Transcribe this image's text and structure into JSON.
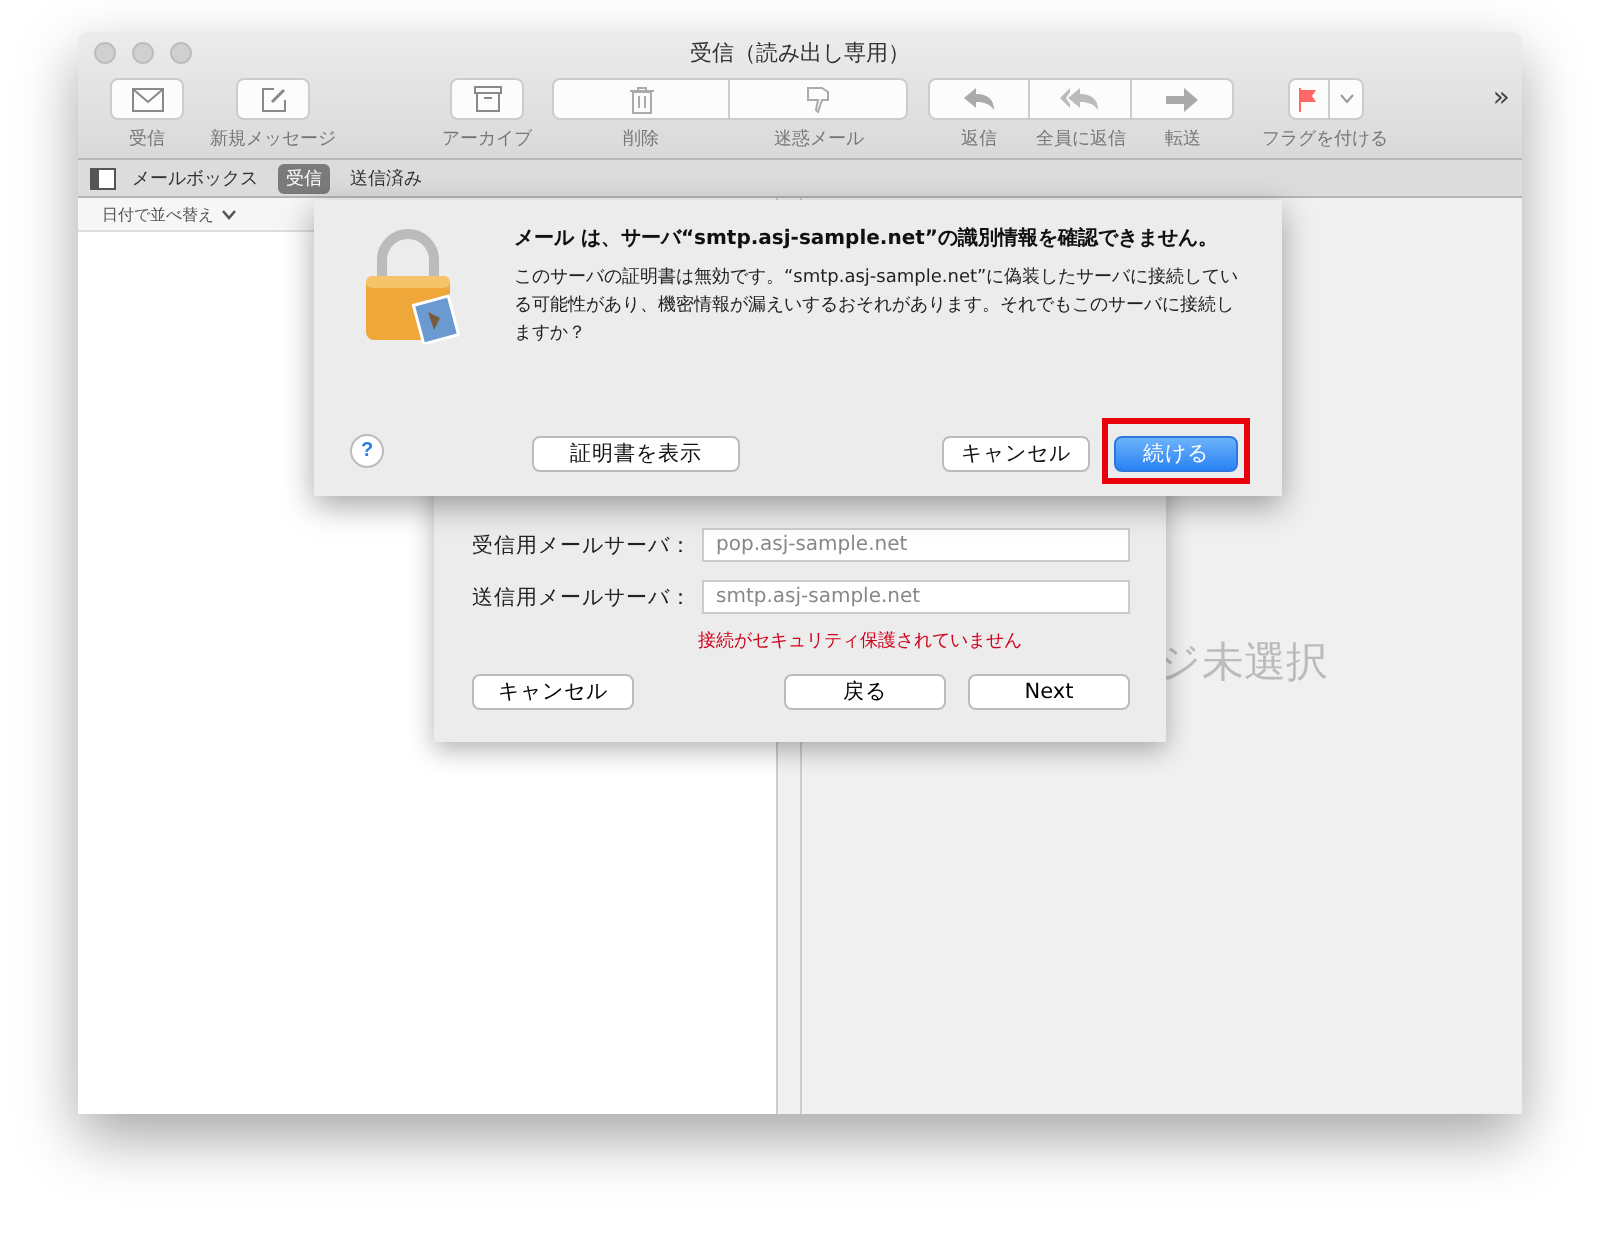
{
  "window": {
    "title": "受信（読み出し専用）"
  },
  "toolbar": [
    {
      "kind": "single",
      "label": "受信"
    },
    {
      "kind": "single",
      "label": "新規メッセージ"
    },
    {
      "kind": "single",
      "label": "アーカイブ"
    },
    {
      "kind": "wide",
      "label": "削除"
    },
    {
      "kind": "wide",
      "label": "迷惑メール"
    },
    {
      "kind": "seg",
      "label": "返信"
    },
    {
      "kind": "seg",
      "label": "全員に返信"
    },
    {
      "kind": "seg",
      "label": "転送"
    },
    {
      "kind": "flag",
      "label": "フラグを付ける"
    }
  ],
  "overflow": "»",
  "favorites": {
    "mailbox_label": "メールボックス",
    "items": [
      {
        "label": "受信",
        "selected": true
      },
      {
        "label": "送信済み",
        "selected": false
      }
    ]
  },
  "list": {
    "sort_label": "日付で並べ替え"
  },
  "viewer": {
    "empty_text": "ジ未選択"
  },
  "setup_sheet": {
    "fields": [
      {
        "label": "受信用メールサーバ：",
        "value": "pop.asj-sample.net"
      },
      {
        "label": "送信用メールサーバ：",
        "value": "smtp.asj-sample.net"
      }
    ],
    "warning": "接続がセキュリティ保護されていません",
    "buttons": [
      {
        "label": "キャンセル"
      },
      {
        "label": "戻る"
      },
      {
        "label": "Next"
      }
    ]
  },
  "alert": {
    "title": "メール は、サーバ“smtp.asj-sample.net”の識別情報を確認できません。",
    "message": "このサーバの証明書は無効です。“smtp.asj-sample.net”に偽装したサーバに接続している可能性があり、機密情報が漏えいするおそれがあります。それでもこのサーバに接続しますか？",
    "help": "?",
    "buttons": [
      {
        "label": "証明書を表示",
        "default": false,
        "highlighted": false
      },
      {
        "label": "キャンセル",
        "default": false,
        "highlighted": false
      },
      {
        "label": "続ける",
        "default": true,
        "highlighted": true
      }
    ]
  }
}
